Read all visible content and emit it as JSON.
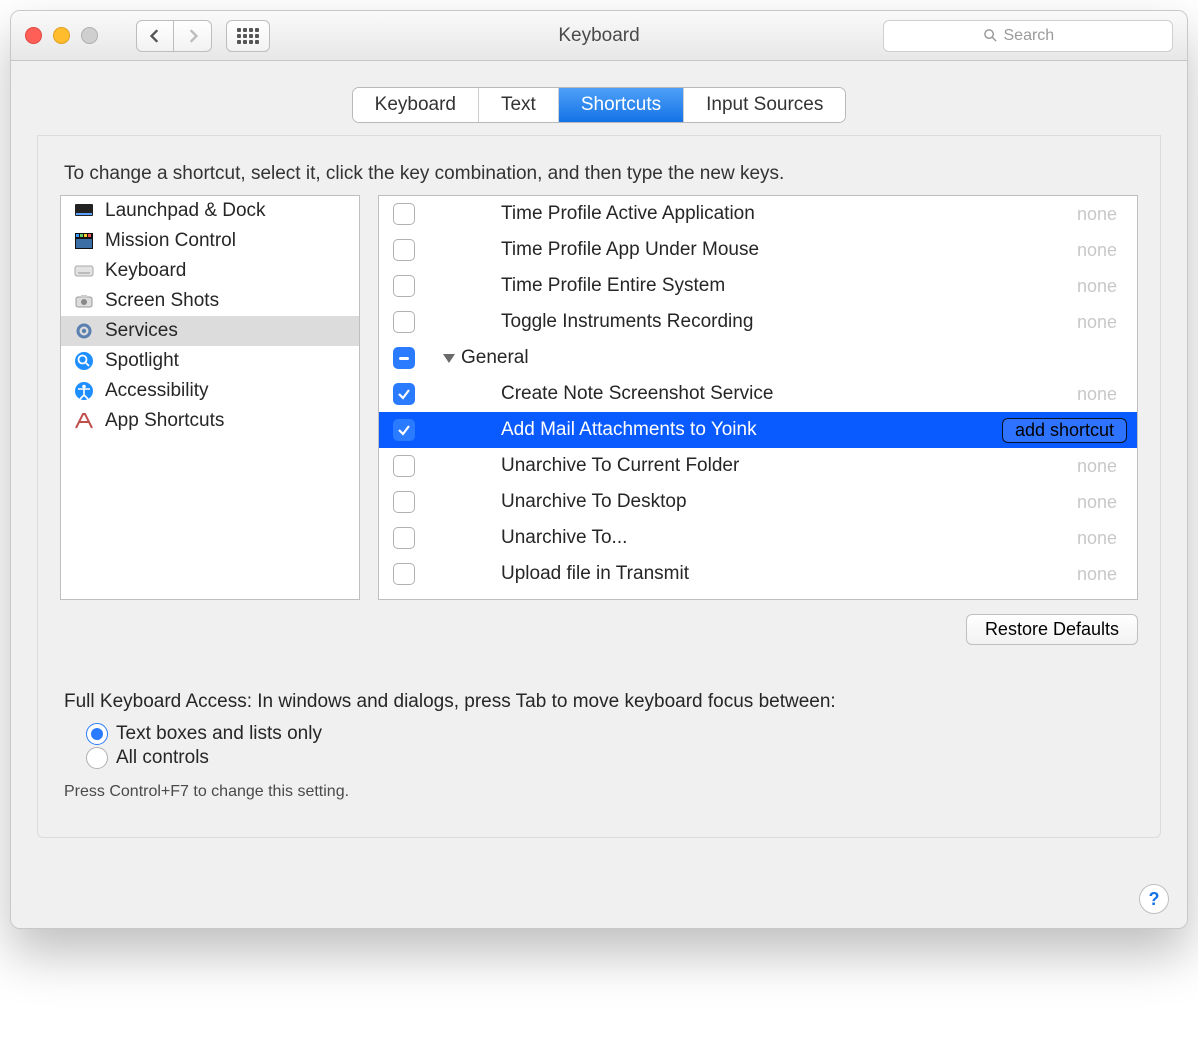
{
  "window": {
    "title": "Keyboard"
  },
  "search": {
    "placeholder": "Search"
  },
  "tabs": [
    "Keyboard",
    "Text",
    "Shortcuts",
    "Input Sources"
  ],
  "active_tab": "Shortcuts",
  "instruction": "To change a shortcut, select it, click the key combination, and then type the new keys.",
  "sidebar": {
    "items": [
      {
        "name": "Launchpad & Dock",
        "selected": false
      },
      {
        "name": "Mission Control",
        "selected": false
      },
      {
        "name": "Keyboard",
        "selected": false
      },
      {
        "name": "Screen Shots",
        "selected": false
      },
      {
        "name": "Services",
        "selected": true
      },
      {
        "name": "Spotlight",
        "selected": false
      },
      {
        "name": "Accessibility",
        "selected": false
      },
      {
        "name": "App Shortcuts",
        "selected": false
      }
    ]
  },
  "detail": {
    "group_label": "General",
    "rows": [
      {
        "label": "Time Profile Active Application",
        "checked": false,
        "shortcut": "none"
      },
      {
        "label": "Time Profile App Under Mouse",
        "checked": false,
        "shortcut": "none"
      },
      {
        "label": "Time Profile Entire System",
        "checked": false,
        "shortcut": "none"
      },
      {
        "label": "Toggle Instruments Recording",
        "checked": false,
        "shortcut": "none"
      },
      {
        "label": "Create Note Screenshot Service",
        "checked": true,
        "shortcut": "none"
      },
      {
        "label": "Add Mail Attachments to Yoink",
        "checked": true,
        "shortcut": "add shortcut",
        "selected": true
      },
      {
        "label": "Unarchive To Current Folder",
        "checked": false,
        "shortcut": "none"
      },
      {
        "label": "Unarchive To Desktop",
        "checked": false,
        "shortcut": "none"
      },
      {
        "label": "Unarchive To...",
        "checked": false,
        "shortcut": "none"
      },
      {
        "label": "Upload file in Transmit",
        "checked": false,
        "shortcut": "none"
      }
    ]
  },
  "buttons": {
    "restore_defaults": "Restore Defaults",
    "add_shortcut": "add shortcut"
  },
  "keyboard_access": {
    "lead": "Full Keyboard Access: In windows and dialogs, press Tab to move keyboard focus between:",
    "option_text_lists": "Text boxes and lists only",
    "option_all": "All controls",
    "hint": "Press Control+F7 to change this setting.",
    "selected": "text_lists"
  }
}
